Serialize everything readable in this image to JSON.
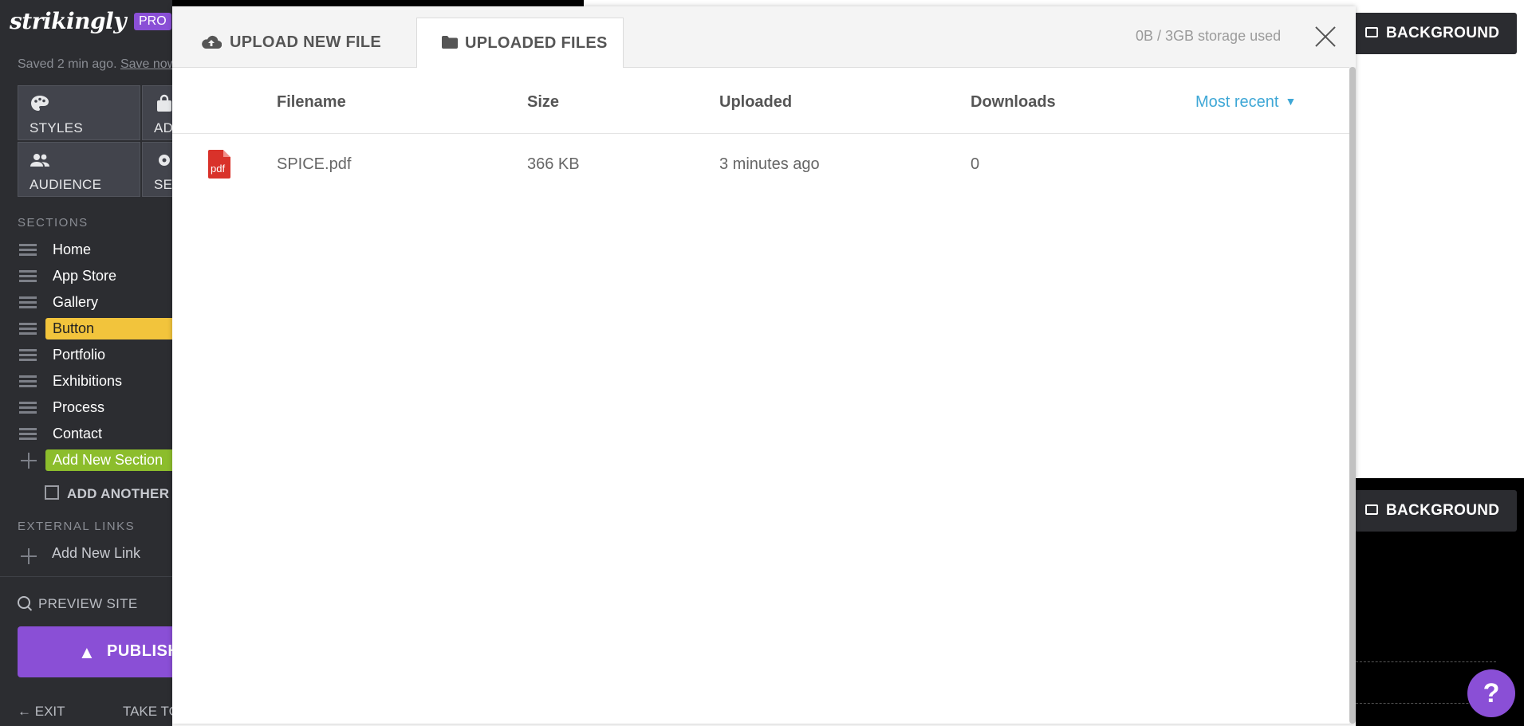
{
  "sidebar": {
    "logo": "strikingly",
    "badge": "PRO",
    "saved_text": "Saved 2 min ago.",
    "save_now": "Save now",
    "tools": [
      {
        "label": "STYLES",
        "icon": "palette-icon"
      },
      {
        "label": "ADD",
        "icon": "shopping-bag-icon"
      },
      {
        "label": "AUDIENCE",
        "icon": "people-icon"
      },
      {
        "label": "SETTINGS",
        "icon": "gear-icon"
      }
    ],
    "sections_title": "SECTIONS",
    "sections": [
      {
        "label": "Home"
      },
      {
        "label": "App Store"
      },
      {
        "label": "Gallery"
      },
      {
        "label": "Button"
      },
      {
        "label": "Portfolio"
      },
      {
        "label": "Exhibitions"
      },
      {
        "label": "Process"
      },
      {
        "label": "Contact"
      }
    ],
    "add_section": "Add New Section",
    "add_another": "ADD ANOTHER",
    "external_links_title": "EXTERNAL LINKS",
    "add_link": "Add New Link",
    "preview": "PREVIEW SITE",
    "publish": "PUBLISH",
    "exit": "EXIT",
    "take_tour": "TAKE TOUR"
  },
  "canvas": {
    "background_label": "BACKGROUND",
    "help": "?"
  },
  "modal": {
    "tabs": [
      {
        "label": "UPLOAD NEW FILE",
        "icon": "cloud-upload-icon"
      },
      {
        "label": "UPLOADED FILES",
        "icon": "folder-icon",
        "active": true
      }
    ],
    "storage_text": "0B / 3GB storage used",
    "columns": [
      "Filename",
      "Size",
      "Uploaded",
      "Downloads"
    ],
    "sort_label": "Most recent",
    "files": [
      {
        "icon": "pdf",
        "filename": "SPICE.pdf",
        "size": "366 KB",
        "uploaded": "3 minutes ago",
        "downloads": "0"
      }
    ]
  },
  "colors": {
    "accent_purple": "#8a4fd6",
    "active_section": "#f2c43c",
    "add_section": "#8cbd2c",
    "link_blue": "#3ea7d6",
    "pdf_red": "#d9322a"
  }
}
